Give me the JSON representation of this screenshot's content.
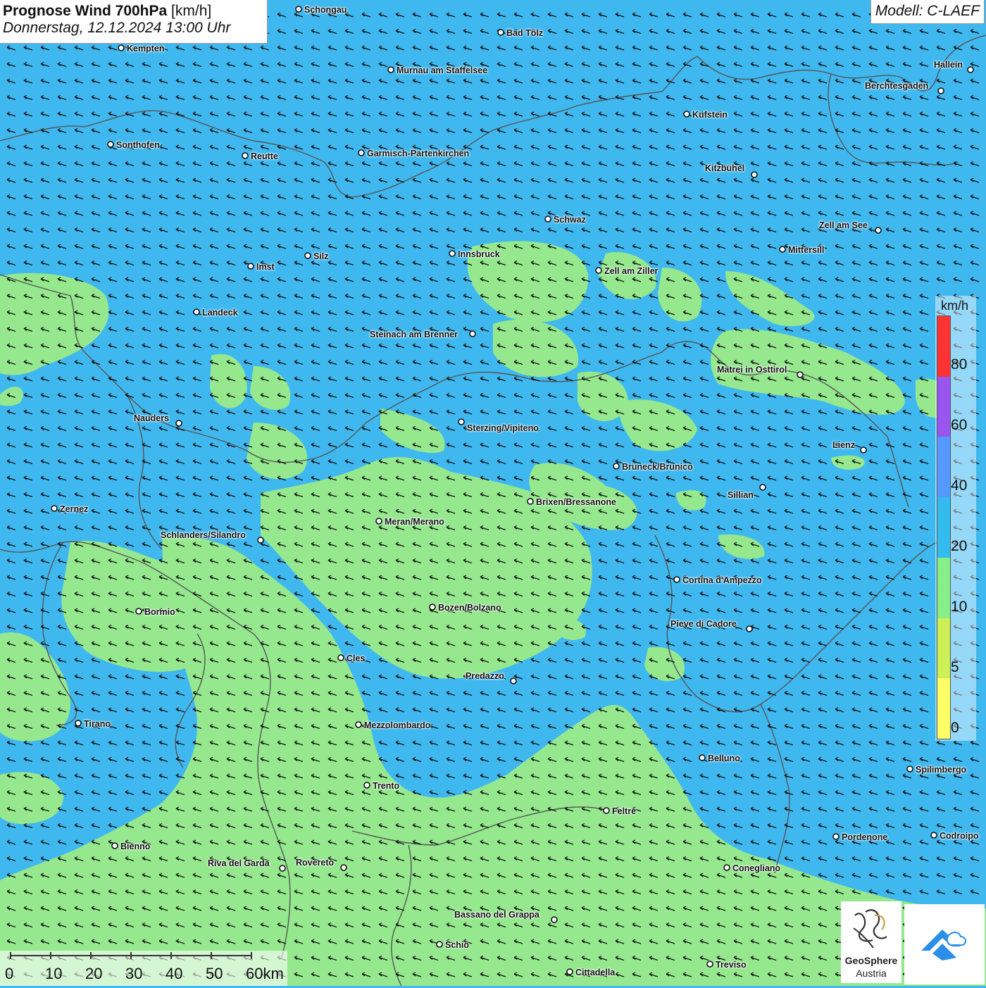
{
  "header": {
    "title_bold": "Prognose Wind 700hPa",
    "title_unit": "[km/h]",
    "subtitle": "Donnerstag, 12.12.2024 13:00 Uhr",
    "model": "Modell: C-LAEF"
  },
  "legend": {
    "unit": "km/h",
    "labels": [
      "80",
      "60",
      "40",
      "20",
      "10",
      "5",
      "0"
    ],
    "colors": [
      "#ff3333",
      "#9955ee",
      "#5599ff",
      "#33bbee",
      "#88ee88",
      "#ccf055",
      "#ffff66"
    ]
  },
  "scale": {
    "labels": [
      "0",
      "10",
      "20",
      "30",
      "40",
      "50",
      "60km"
    ]
  },
  "logo": {
    "name": "GeoSphere",
    "country": "Austria"
  },
  "colors": {
    "wind_10_20": "#3fb8f0",
    "wind_5_10": "#95e88e",
    "border": "#555555",
    "arrow": "#111111"
  },
  "cities": [
    {
      "name": "Schongau"
    },
    {
      "name": "Bad Tölz"
    },
    {
      "name": "Kempten"
    },
    {
      "name": "Murnau am Staffelsee"
    },
    {
      "name": "Hallein"
    },
    {
      "name": "Berchtesgaden"
    },
    {
      "name": "Kufstein"
    },
    {
      "name": "Sonthofen"
    },
    {
      "name": "Reutte"
    },
    {
      "name": "Garmisch-Partenkirchen"
    },
    {
      "name": "Kitzbühel"
    },
    {
      "name": "Schwaz"
    },
    {
      "name": "Zell am See"
    },
    {
      "name": "Mittersill"
    },
    {
      "name": "Innsbruck"
    },
    {
      "name": "Silz"
    },
    {
      "name": "Imst"
    },
    {
      "name": "Zell am Ziller"
    },
    {
      "name": "Landeck"
    },
    {
      "name": "Steinach am Brenner"
    },
    {
      "name": "Matrei in Osttirol"
    },
    {
      "name": "Nauders"
    },
    {
      "name": "Sterzing/Vipiteno"
    },
    {
      "name": "Lienz"
    },
    {
      "name": "Bruneck/Brunico"
    },
    {
      "name": "Sillian"
    },
    {
      "name": "Zernez"
    },
    {
      "name": "Brixen/Bressanone"
    },
    {
      "name": "Meran/Merano"
    },
    {
      "name": "Schlanders/Silandro"
    },
    {
      "name": "Cortina d'Ampezzo"
    },
    {
      "name": "Bormio"
    },
    {
      "name": "Bozen/Bolzano"
    },
    {
      "name": "Pieve di Cadore"
    },
    {
      "name": "Cles"
    },
    {
      "name": "Predazzo"
    },
    {
      "name": "Tirano"
    },
    {
      "name": "Mezzolombardo"
    },
    {
      "name": "Belluno"
    },
    {
      "name": "Spilimbergo"
    },
    {
      "name": "Trento"
    },
    {
      "name": "Feltre"
    },
    {
      "name": "Pordenone"
    },
    {
      "name": "Codroipo"
    },
    {
      "name": "Bienno"
    },
    {
      "name": "Riva del Garda"
    },
    {
      "name": "Rovereto"
    },
    {
      "name": "Conegliano"
    },
    {
      "name": "Bassano del Grappa"
    },
    {
      "name": "Schio"
    },
    {
      "name": "Treviso"
    },
    {
      "name": "Cittadella"
    }
  ]
}
